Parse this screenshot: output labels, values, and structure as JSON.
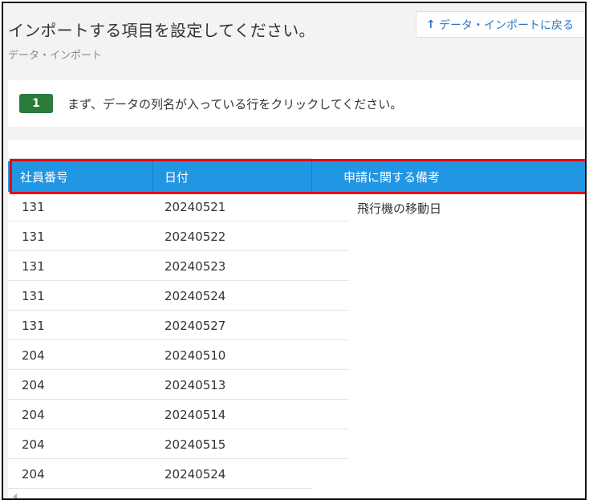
{
  "header": {
    "title": "インポートする項目を設定してください。",
    "subtitle": "データ・インポート",
    "back_button_label": "データ・インポートに戻る",
    "back_button_icon": "arrow-up-icon"
  },
  "instruction": {
    "step_number": "1",
    "text": "まず、データの列名が入っている行をクリックしてください。"
  },
  "table": {
    "headers": [
      "社員番号",
      "日付",
      "申請に関する備考"
    ],
    "rows": [
      {
        "id": "131",
        "date": "20240521",
        "remark": "飛行機の移動日"
      },
      {
        "id": "131",
        "date": "20240522",
        "remark": ""
      },
      {
        "id": "131",
        "date": "20240523",
        "remark": ""
      },
      {
        "id": "131",
        "date": "20240524",
        "remark": ""
      },
      {
        "id": "131",
        "date": "20240527",
        "remark": ""
      },
      {
        "id": "204",
        "date": "20240510",
        "remark": ""
      },
      {
        "id": "204",
        "date": "20240513",
        "remark": ""
      },
      {
        "id": "204",
        "date": "20240514",
        "remark": ""
      },
      {
        "id": "204",
        "date": "20240515",
        "remark": ""
      },
      {
        "id": "204",
        "date": "20240524",
        "remark": ""
      }
    ]
  },
  "colors": {
    "header_row": "#2196e3",
    "highlight": "#e60012",
    "step_badge": "#2b7b3a",
    "link": "#2a78c6"
  }
}
